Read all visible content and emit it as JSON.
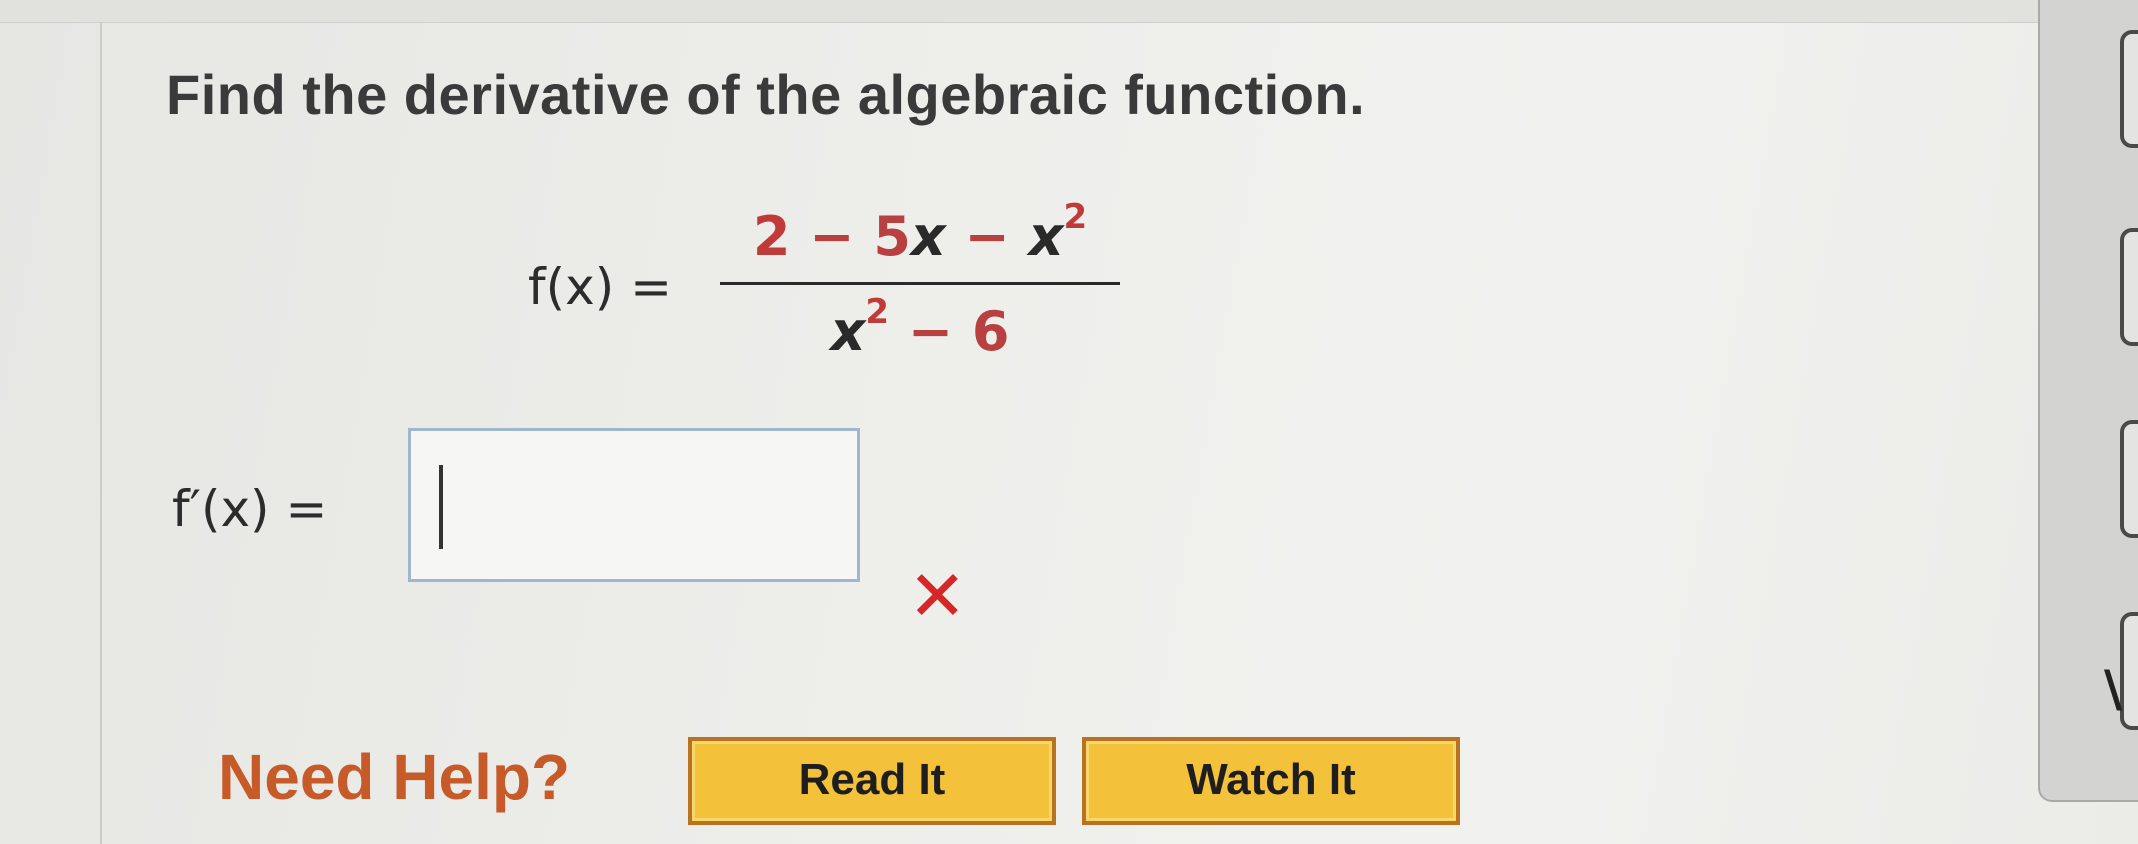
{
  "question": {
    "prompt": "Find the derivative of the algebraic function."
  },
  "function": {
    "label": "f(x) =",
    "numerator": {
      "t1": "2",
      "op1": " − 5",
      "var1": "x",
      "op2": " − ",
      "var2": "x",
      "exp2": "2"
    },
    "denominator": {
      "var1": "x",
      "exp1": "2",
      "op1": " − 6"
    }
  },
  "answer": {
    "label": "f′(x) =",
    "value": "",
    "status": "incorrect",
    "status_mark": "✕"
  },
  "help": {
    "label": "Need Help?",
    "read_button": "Read It",
    "watch_button": "Watch It"
  },
  "colors": {
    "highlight_red": "#c13a3a",
    "button_gold": "#f3c13a",
    "help_orange": "#c65a28",
    "wrong_red": "#d52727"
  },
  "side_panel": {
    "glyph": "\\"
  }
}
